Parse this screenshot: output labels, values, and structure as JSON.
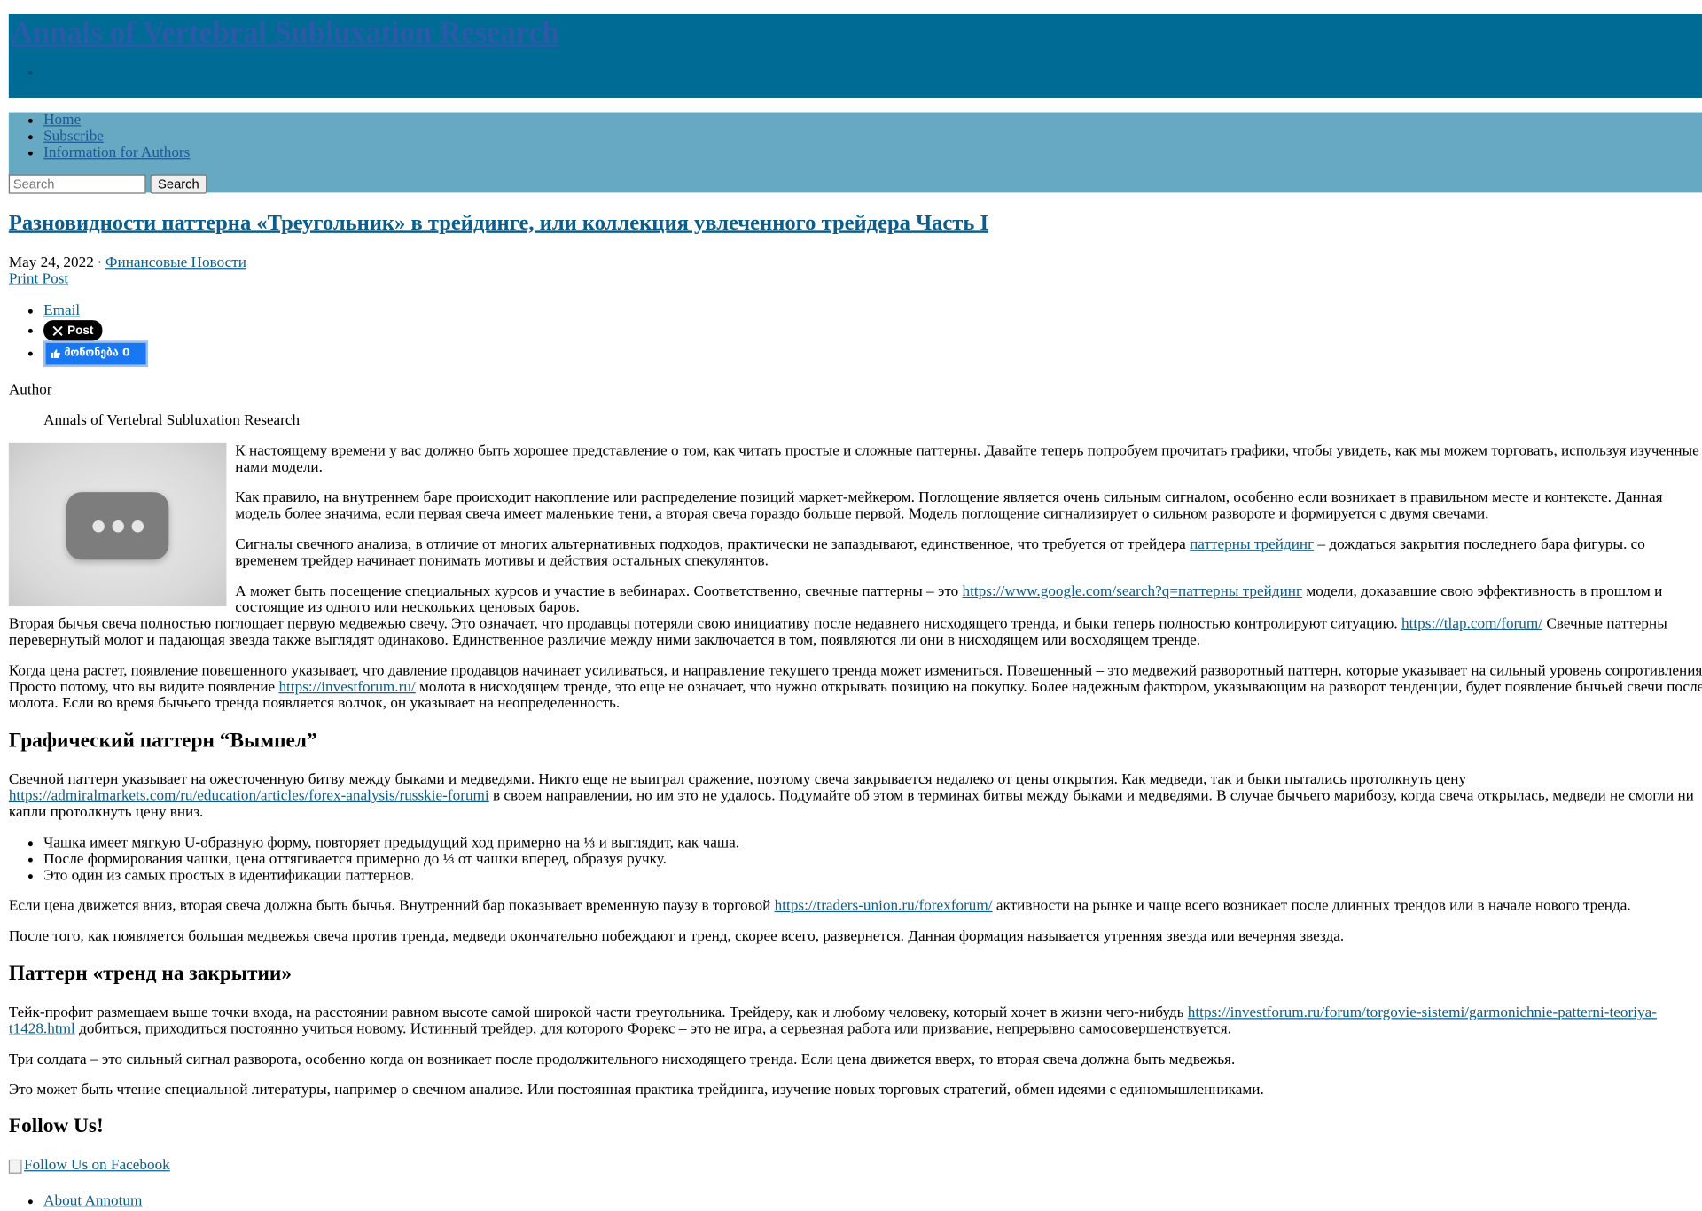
{
  "site": {
    "title": "Annals of Vertebral Subluxation Research"
  },
  "nav": {
    "items": [
      {
        "label": "Home"
      },
      {
        "label": "Subscribe"
      },
      {
        "label": "Information for Authors"
      }
    ],
    "search_placeholder": "Search",
    "search_button": "Search"
  },
  "post": {
    "title": "Разновидности паттерна «Треугольник» в трейдинге, или коллекция увлеченного трейдера Часть I",
    "date": "May 24, 2022",
    "separator": "·",
    "category": "Финансовые Новости",
    "print_label": "Print Post",
    "share": {
      "email": "Email",
      "x_post": "Post",
      "fb_like": "მოწონება 0"
    },
    "author_label": "Author",
    "author_name": "Annals of Vertebral Subluxation Research"
  },
  "content": {
    "p1": "К настоящему времени у вас должно быть хорошее представление о том, как читать простые и сложные паттерны. Давайте теперь попробуем прочитать графики, чтобы увидеть, как мы можем торговать, используя изученные нами модели.",
    "p2": "Как правило, на внутреннем баре происходит накопление или распределение позиций маркет-мейкером. Поглощение является очень сильным сигналом, особенно если возникает в правильном месте и контексте. Данная модель более значима, если первая свеча имеет маленькие тени, а вторая свеча гораздо больше первой. Модель поглощение сигнализирует о сильном развороте и формируется с двумя свечами.",
    "p3_before": "Сигналы свечного анализа, в отличие от многих альтернативных подходов, практически не запаздывают, единственное, что требуется от трейдера ",
    "p3_link": "паттерны трейдинг",
    "p3_after": " – дождаться закрытия последнего бара фигуры. со временем трейдер начинает понимать мотивы и действия остальных спекулянтов.",
    "p4_before": "А может быть посещение специальных курсов и участие в вебинарах. Соответственно, свечные паттерны – это ",
    "p4_link": "https://www.google.com/search?q=паттерны трейдинг",
    "p4_after": " модели, доказавшие свою эффективность в прошлом и состоящие из одного или нескольких ценовых баров.",
    "p5_before": "Вторая бычья свеча полностью поглощает первую медвежью свечу. Это означает, что продавцы потеряли свою инициативу после недавнего нисходящего тренда, и быки теперь полностью контролируют ситуацию. ",
    "p5_link": "https://tlap.com/forum/",
    "p5_after": " Свечные паттерны перевернутый молот и падающая звезда также выглядят одинаково. Единственное различие между ними заключается в том, появляются ли они в нисходящем или восходящем тренде.",
    "p6_before": "Когда цена растет, появление повешенного указывает, что давление продавцов начинает усиливаться, и направление текущего тренда может измениться. Повешенный – это медвежий разворотный паттерн, которые указывает на сильный уровень сопротивления. Просто потому, что вы видите появление ",
    "p6_link": "https://investforum.ru/",
    "p6_after": " молота в нисходящем тренде, это еще не означает, что нужно открывать позицию на покупку. Более надежным фактором, указывающим на разворот тенденции, будет появление бычьей свечи после молота. Если во время бычьего тренда появляется волчок, он указывает на неопределенность.",
    "h2_1": "Графический паттерн “Вымпел”",
    "p7_before": "Свечной паттерн указывает на ожесточенную битву между быками и медведями. Никто еще не выиграл сражение, поэтому свеча закрывается недалеко от цены открытия. Как медведи, так и быки пытались протолкнуть цену ",
    "p7_link": "https://admiralmarkets.com/ru/education/articles/forex-analysis/russkie-forumi",
    "p7_after": " в своем направлении, но им это не удалось. Подумайте об этом в терминах битвы между быками и медведями. В случае бычьего марибозу, когда свеча открылась, медведи не смогли ни капли протолкнуть цену вниз.",
    "list": [
      "Чашка имеет мягкую U-образную форму, повторяет предыдущий ход примерно на ⅓ и выглядит, как чаша.",
      "После формирования чашки, цена оттягивается примерно до ⅓ от чашки вперед, образуя ручку.",
      "Это один из самых простых в идентификации паттернов."
    ],
    "p8_before": "Если цена движется вниз, вторая свеча должна быть бычья. Внутренний бар показывает временную паузу в торговой ",
    "p8_link": "https://traders-union.ru/forexforum/",
    "p8_after": " активности на рынке и чаще всего возникает после длинных трендов или в начале нового тренда.",
    "p9": "После того, как появляется большая медвежья свеча против тренда, медведи окончательно побеждают и тренд, скорее всего, развернется. Данная формация называется утренняя звезда или вечерняя звезда.",
    "h2_2": "Паттерн «тренд на закрытии»",
    "p10_before": "Тейк-профит размещаем выше точки входа, на расстоянии равном высоте самой широкой части треугольника. Трейдеру, как и любому человеку, который хочет в жизни чего-нибудь ",
    "p10_link": "https://investforum.ru/forum/torgovie-sistemi/garmonichnie-patterni-teoriya-t1428.html",
    "p10_after": " добиться, приходиться постоянно учиться новому. Истинный трейдер, для которого Форекс – это не игра, а серьезная работа или призвание, непрерывно самосовершенствуется.",
    "p11": "Три солдата – это сильный сигнал разворота, особенно когда он возникает после продолжительного нисходящего тренда. Если цена движется вверх, то вторая свеча должна быть медвежья.",
    "p12": "Это может быть чтение специальной литературы, например о свечном анализе. Или постоянная практика трейдинга, изучение новых торговых стратегий, обмен идеями с единомышленниками."
  },
  "follow": {
    "heading": "Follow Us!",
    "facebook_alt": "Follow Us on Facebook",
    "links": [
      {
        "label": "About Annotum"
      }
    ]
  },
  "colors": {
    "header_bg": "#006c96",
    "nav_bg": "#67a8c2",
    "link": "#0b5d8c"
  },
  "icons": {
    "thumbnail": "speech-bubble-ellipsis-icon",
    "x_logo": "x-logo-icon",
    "thumbs_up": "thumbs-up-icon"
  }
}
